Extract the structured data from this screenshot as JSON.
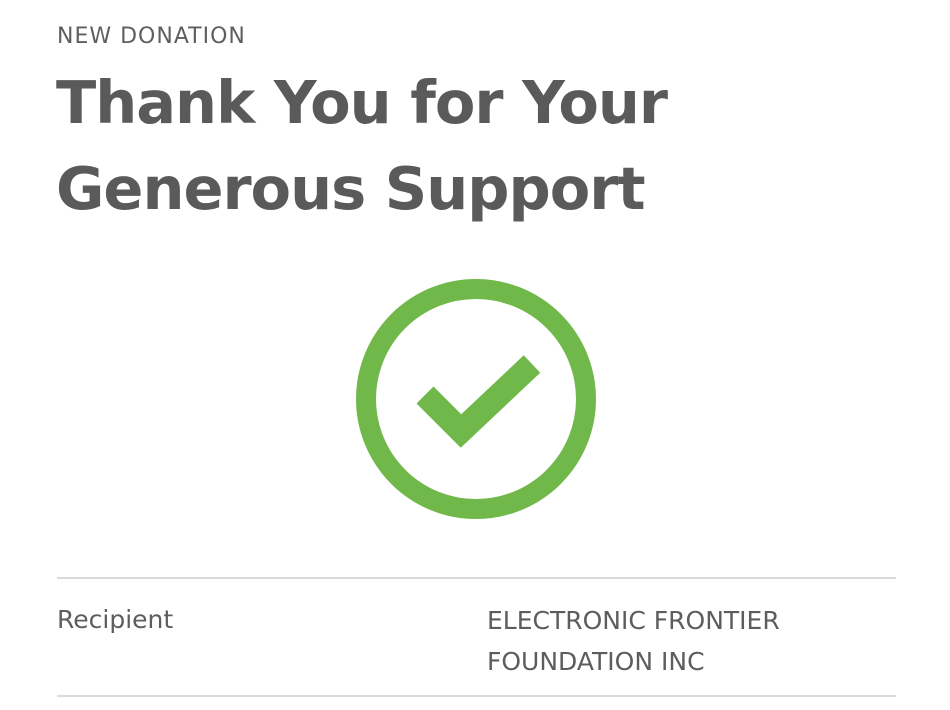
{
  "header": {
    "eyebrow": "NEW DONATION",
    "title": "Thank You for Your Generous Support"
  },
  "status": {
    "icon": "check-circle-icon",
    "color": "#71b84b"
  },
  "details": {
    "recipient_label": "Recipient",
    "recipient_value": "ELECTRONIC FRONTIER FOUNDATION INC"
  }
}
